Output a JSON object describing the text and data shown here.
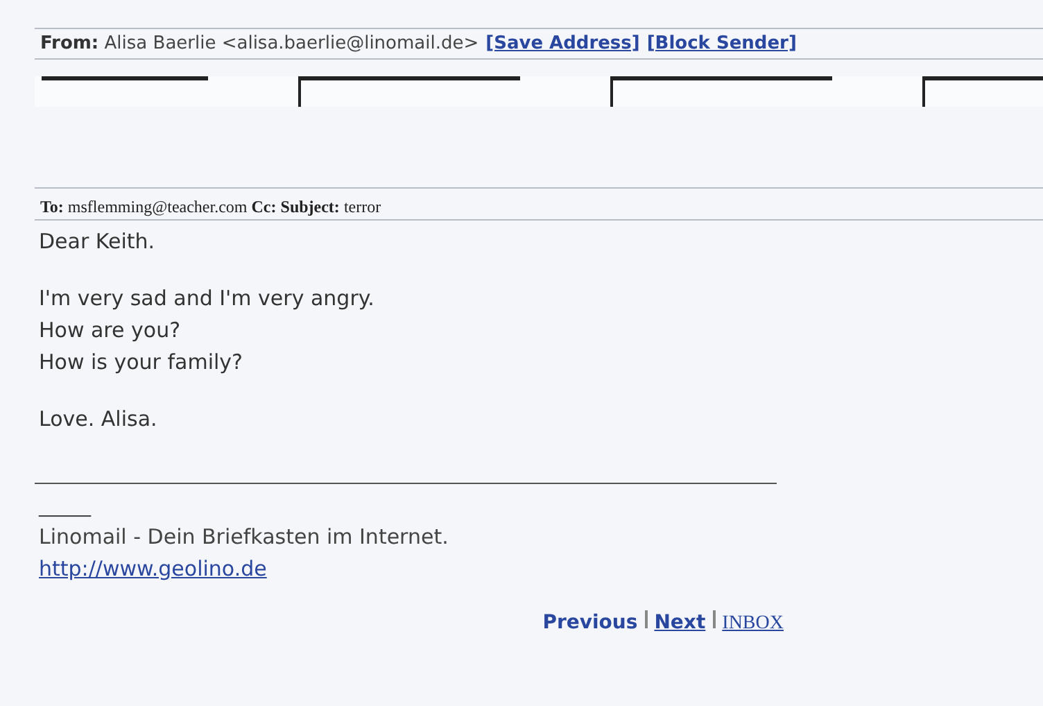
{
  "header": {
    "from_label": "From:",
    "from_value": "Alisa Baerlie <alisa.baerlie@linomail.de>",
    "actions": [
      {
        "label": "[Save Address]"
      },
      {
        "label": "[Block Sender]"
      }
    ]
  },
  "controls": [
    {
      "kind": "line"
    },
    {
      "kind": "box"
    },
    {
      "kind": "box"
    },
    {
      "kind": "box"
    }
  ],
  "meta": {
    "to_label": "To:",
    "to_value": "msflemming@teacher.com",
    "cc_label": "Cc:",
    "subject_label": "Subject:",
    "subject_value": "terror"
  },
  "body": {
    "paragraphs": [
      [
        "Dear Keith."
      ],
      [
        "I'm very sad and I'm very angry.",
        "How are you?",
        "How is your family?"
      ],
      [
        "Love. Alisa."
      ]
    ]
  },
  "signature": {
    "dash": "_____",
    "text": "Linomail - Dein Briefkasten im Internet.",
    "link": "http://www.geolino.de"
  },
  "nav": [
    {
      "label": "Previous",
      "kind": "plain"
    },
    {
      "label": "Next",
      "kind": "underlined"
    },
    {
      "label": "INBOX",
      "kind": "folder"
    }
  ]
}
